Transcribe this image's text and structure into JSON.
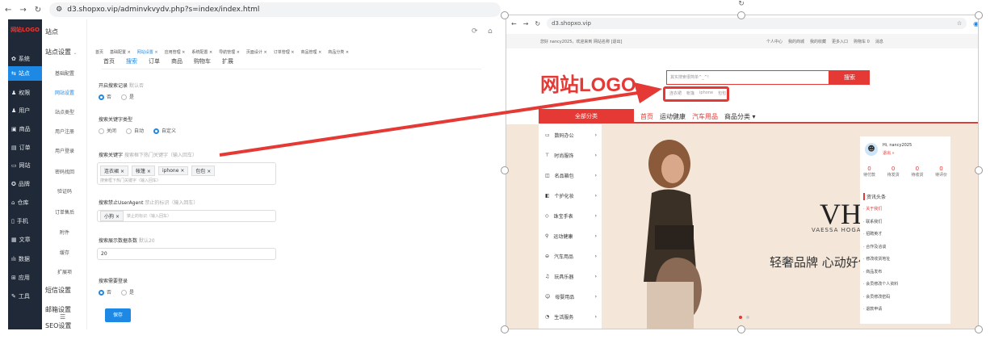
{
  "left_browser": {
    "url": "d3.shopxo.vip/adminvkvydv.php?s=index/index.html",
    "sidebar": {
      "logo": "网站LOGO",
      "items": [
        {
          "label": "系统",
          "icon": "gear-icon"
        },
        {
          "label": "站点",
          "icon": "toggle-icon",
          "active": true
        },
        {
          "label": "权限",
          "icon": "user-icon"
        },
        {
          "label": "用户",
          "icon": "user-icon"
        },
        {
          "label": "商品",
          "icon": "box-icon"
        },
        {
          "label": "订单",
          "icon": "list-icon"
        },
        {
          "label": "网站",
          "icon": "monitor-icon"
        },
        {
          "label": "品牌",
          "icon": "star-icon"
        },
        {
          "label": "仓库",
          "icon": "warehouse-icon"
        },
        {
          "label": "手机",
          "icon": "phone-icon"
        },
        {
          "label": "文章",
          "icon": "doc-icon"
        },
        {
          "label": "数据",
          "icon": "chart-icon"
        },
        {
          "label": "应用",
          "icon": "grid-icon"
        },
        {
          "label": "工具",
          "icon": "wrench-icon"
        }
      ]
    },
    "subnav": {
      "header": "站点",
      "group": "站点设置",
      "items": [
        "基础配置",
        "网站设置",
        "站点类型",
        "用户注册",
        "用户登录",
        "密码找回",
        "验证码",
        "订单售后",
        "附件",
        "缓存",
        "扩展项"
      ],
      "groups": [
        "短信设置",
        "邮箱设置",
        "SEO设置"
      ]
    },
    "tabs": [
      "首页",
      "基础配置 ×",
      "网站设置 ×",
      "应用管理 ×",
      "系统配置 ×",
      "导航管理 ×",
      "页面设计 ×",
      "订单管理 ×",
      "商品管理 ×",
      "商品分类 ×"
    ],
    "subtabs": [
      "首页",
      "搜索",
      "订单",
      "商品",
      "购物车",
      "扩展"
    ],
    "form": {
      "record_label": "开启搜索记录",
      "record_hint": "默认否",
      "opt_no": "否",
      "opt_yes": "是",
      "keyword_type_label": "搜索关键字类型",
      "kt_close": "关闭",
      "kt_auto": "自动",
      "kt_custom": "自定义",
      "keyword_label": "搜索关键字",
      "keyword_hint": "搜索框下热门关键字（输入回车）",
      "keywords": [
        "连衣裙",
        "帐篷",
        "iphone",
        "包包"
      ],
      "keyword_placeholder": "搜索框下热门关键字（输入回车）",
      "ua_label": "搜索禁止UserAgent",
      "ua_hint": "禁止的标识（输入回车）",
      "ua_tags": [
        "小狗"
      ],
      "ua_placeholder": "禁止的标识（输入回车）",
      "count_label": "搜索展示数据条数",
      "count_hint": "默认20",
      "count_value": "20",
      "login_label": "搜索需要登录",
      "save": "保存"
    }
  },
  "right_browser": {
    "url": "d3.shopxo.vip",
    "topbar_left": "您好 nancy2025，欢迎来到 网站名称 [退出]",
    "topbar_right": [
      "个人中心",
      "我的商城",
      "我的收藏",
      "更多入口",
      "购物车 0",
      "消息"
    ],
    "logo": "网站LOGO",
    "search_placeholder": "其实搜索很简单^_^!",
    "search_button": "搜索",
    "hot_keywords": [
      "连衣裙",
      "帐篷",
      "iphone",
      "包包"
    ],
    "all_categories": "全部分类",
    "nav": [
      "首页",
      "运动健康",
      "汽车用品",
      "商品分类 ▾"
    ],
    "categories": [
      "数码办公",
      "时尚服饰",
      "名品箱包",
      "个护化妆",
      "珠宝手表",
      "运动健康",
      "汽车用品",
      "玩具乐器",
      "母婴用品",
      "生活服务"
    ],
    "banner_brand": "VH",
    "banner_brand_sub": "VAESSA HOGAN",
    "banner_slogan": "轻奢品牌 心动好价",
    "user": {
      "greeting": "Hi, nancy2025",
      "logout": "退出 »",
      "stats": [
        {
          "count": "0",
          "label": "待付款"
        },
        {
          "count": "0",
          "label": "待发货"
        },
        {
          "count": "0",
          "label": "待收货"
        },
        {
          "count": "0",
          "label": "待评价"
        }
      ],
      "news_title": "资讯头条",
      "news": [
        "关于我们",
        "联系我们",
        "招聘英才",
        "合作及洽谈",
        "修改收货地址",
        "商品发布",
        "会员修改个人资料",
        "会员修改密码",
        "退款申请"
      ]
    }
  },
  "colors": {
    "accent": "#e53935",
    "admin_blue": "#1e88e5",
    "sidebar_bg": "#1f2937"
  }
}
